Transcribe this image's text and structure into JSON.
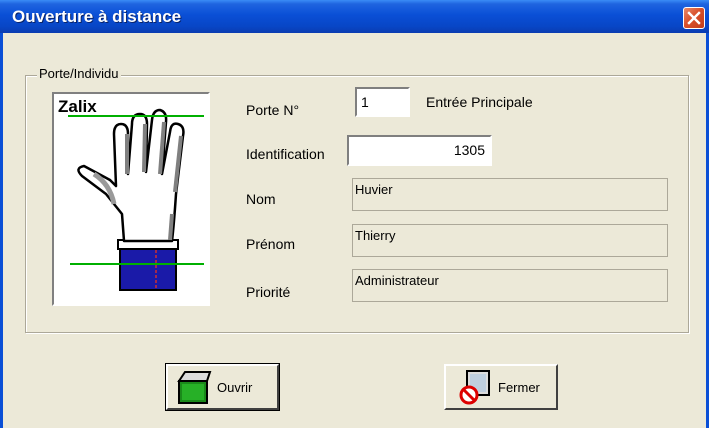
{
  "window": {
    "title": "Ouverture à distance",
    "close_icon": "close-icon"
  },
  "group": {
    "legend": "Porte/Individu"
  },
  "image": {
    "brand_text": "Zalix",
    "icon": "hand-scanner-icon"
  },
  "form": {
    "porte_label": "Porte N°",
    "porte_value": "1",
    "porte_name": "Entrée Principale",
    "identification_label": "Identification",
    "identification_value": "1305",
    "nom_label": "Nom",
    "nom_value": "Huvier",
    "prenom_label": "Prénom",
    "prenom_value": "Thierry",
    "priorite_label": "Priorité",
    "priorite_value": "Administrateur"
  },
  "buttons": {
    "open_label": "Ouvrir",
    "open_icon": "door-open-icon",
    "close_label": "Fermer",
    "close_icon": "door-closed-icon"
  },
  "colors": {
    "title_bar": "#0a4fd6",
    "close_button": "#d9512c",
    "scan_line": "#00b000"
  }
}
